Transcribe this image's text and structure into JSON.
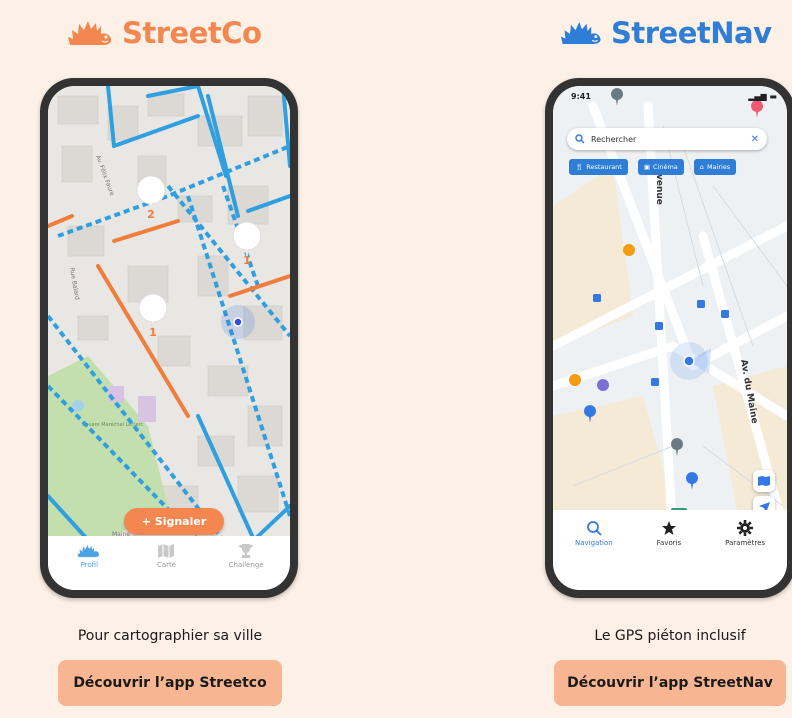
{
  "left": {
    "brand": "StreetCo",
    "brand_color": "#f3874f",
    "signal_button": "+ Signaler",
    "markers": [
      "2",
      "1",
      "1"
    ],
    "tabs": [
      {
        "label": "Profil",
        "icon": "hedgehog-icon",
        "active": true
      },
      {
        "label": "Carte",
        "icon": "map-icon",
        "active": false
      },
      {
        "label": "Challenge",
        "icon": "trophy-icon",
        "active": false
      }
    ],
    "map_labels": [
      "Av. Félix Faure",
      "Rue Balard",
      "Square Maréchal Leclerc",
      "Maine"
    ],
    "caption": "Pour cartographier sa ville",
    "cta": "Découvrir l’app Streetco"
  },
  "right": {
    "brand": "StreetNav",
    "brand_color": "#2e7dd6",
    "time": "9:41",
    "search_placeholder": "Rechercher",
    "chips": [
      {
        "label": "Restaurant",
        "icon": "fork-knife-icon"
      },
      {
        "label": "Cinéma",
        "icon": "film-icon"
      },
      {
        "label": "Mairies",
        "icon": "town-hall-icon"
      }
    ],
    "map_labels": [
      "venue",
      "Av. du Maine"
    ],
    "tabs": [
      {
        "label": "Navigation",
        "icon": "search-icon",
        "active": true
      },
      {
        "label": "Favoris",
        "icon": "star-icon",
        "active": false
      },
      {
        "label": "Paramètres",
        "icon": "gear-icon",
        "active": false
      }
    ],
    "caption": "Le GPS piéton inclusif",
    "cta": "Découvrir l’app StreetNav"
  },
  "colors": {
    "background": "#fdf0e6",
    "accessible_route": "#2f9fe0",
    "obstacle_route": "#f07d3c",
    "nav_blue": "#2e7dd6",
    "cta_background": "#f8b592"
  }
}
